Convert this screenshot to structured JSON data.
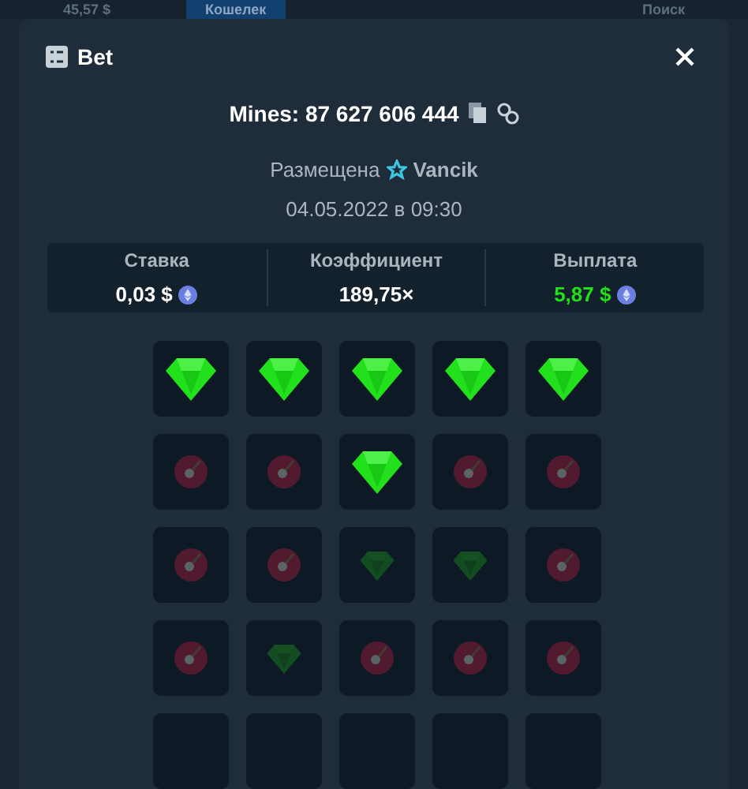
{
  "background_header": {
    "balance": "45,57 $",
    "wallet_button": "Кошелек",
    "search": "Поиск"
  },
  "dialog": {
    "title": "Bet",
    "game_id": "Mines: 87 627 606 444",
    "placed_label": "Размещена",
    "player": "Vancik",
    "date": "04.05.2022 в 09:30",
    "stats": [
      {
        "label": "Ставка",
        "value": "0,03 $",
        "coin": true,
        "highlight": false
      },
      {
        "label": "Коэффициент",
        "value": "189,75×",
        "coin": false,
        "highlight": false
      },
      {
        "label": "Выплата",
        "value": "5,87 $",
        "coin": true,
        "highlight": true
      }
    ],
    "grid": [
      [
        {
          "kind": "gem",
          "revealed": true
        },
        {
          "kind": "gem",
          "revealed": true
        },
        {
          "kind": "gem",
          "revealed": true
        },
        {
          "kind": "gem",
          "revealed": true
        },
        {
          "kind": "gem",
          "revealed": true
        }
      ],
      [
        {
          "kind": "mine",
          "revealed": false
        },
        {
          "kind": "mine",
          "revealed": false
        },
        {
          "kind": "gem",
          "revealed": true
        },
        {
          "kind": "mine",
          "revealed": false
        },
        {
          "kind": "mine",
          "revealed": false
        }
      ],
      [
        {
          "kind": "mine",
          "revealed": false
        },
        {
          "kind": "mine",
          "revealed": false
        },
        {
          "kind": "gem",
          "revealed": false
        },
        {
          "kind": "gem",
          "revealed": false
        },
        {
          "kind": "mine",
          "revealed": false
        }
      ],
      [
        {
          "kind": "mine",
          "revealed": false
        },
        {
          "kind": "gem",
          "revealed": false
        },
        {
          "kind": "mine",
          "revealed": false
        },
        {
          "kind": "mine",
          "revealed": false
        },
        {
          "kind": "mine",
          "revealed": false
        }
      ]
    ]
  }
}
